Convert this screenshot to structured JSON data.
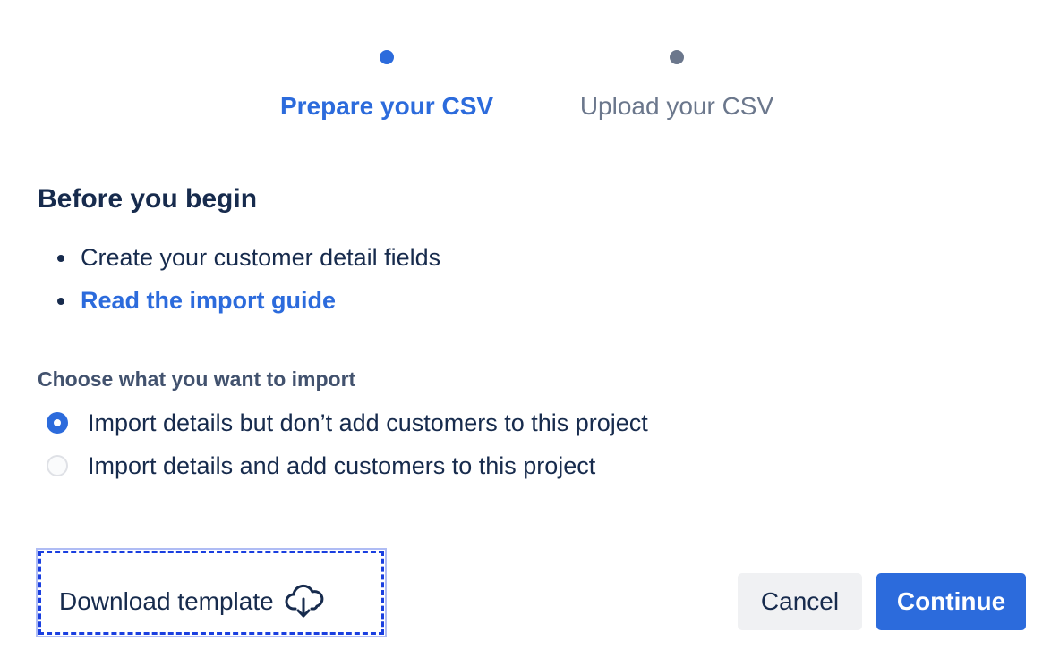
{
  "stepper": {
    "steps": [
      {
        "label": "Prepare your CSV",
        "state": "active"
      },
      {
        "label": "Upload your CSV",
        "state": "inactive"
      }
    ]
  },
  "intro": {
    "heading": "Before you begin",
    "items": [
      {
        "text": "Create your customer detail fields",
        "type": "text"
      },
      {
        "text": "Read the import guide",
        "type": "link"
      }
    ]
  },
  "import_choice": {
    "label": "Choose what you want to import",
    "options": [
      {
        "label": "Import details but don’t add customers to this project",
        "checked": true
      },
      {
        "label": "Import details and add customers to this project",
        "checked": false
      }
    ]
  },
  "footer": {
    "download_label": "Download template",
    "download_icon": "cloud-download-icon",
    "cancel_label": "Cancel",
    "continue_label": "Continue"
  },
  "colors": {
    "accent": "#2c6bdc",
    "text": "#172b4d",
    "muted": "#6b778c",
    "highlight_border": "#1a3fe0"
  }
}
